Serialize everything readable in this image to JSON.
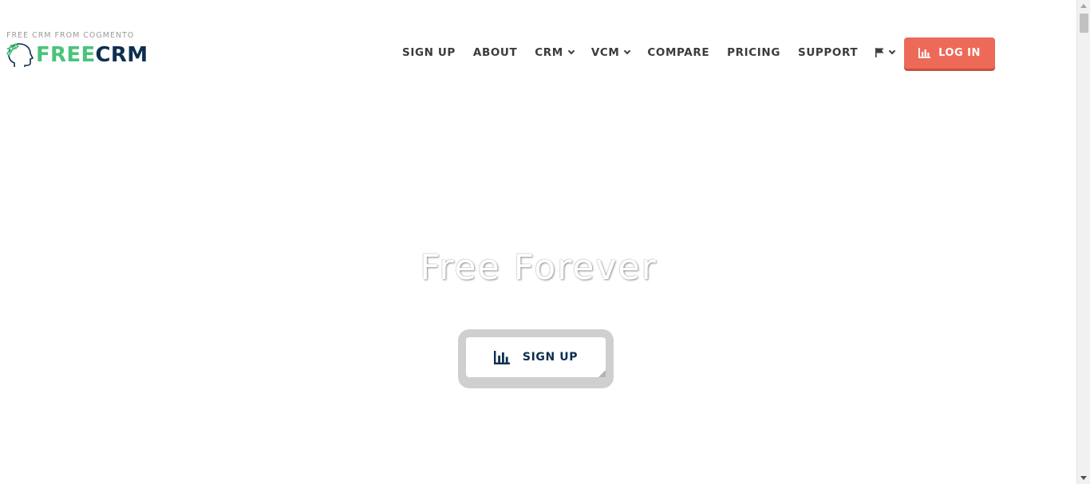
{
  "header": {
    "tagline": "FREE CRM FROM COGMENTO",
    "logo": {
      "part1": "FREE",
      "part2": "CRM",
      "icon": "head-gears-icon",
      "colors": {
        "free": "#49c47a",
        "crm": "#0d2f4f"
      }
    }
  },
  "nav": {
    "items": [
      {
        "label": "SIGN UP"
      },
      {
        "label": "ABOUT"
      },
      {
        "label": "CRM",
        "dropdown": true
      },
      {
        "label": "VCM",
        "dropdown": true
      },
      {
        "label": "COMPARE"
      },
      {
        "label": "PRICING"
      },
      {
        "label": "SUPPORT"
      }
    ],
    "language": {
      "icon": "flag-icon",
      "dropdown": true
    },
    "login": {
      "label": "LOG IN",
      "icon": "bar-chart-icon",
      "color": "#ec6a57"
    }
  },
  "hero": {
    "title": "Free Forever",
    "cta": {
      "label": "SIGN UP",
      "icon": "bar-chart-icon"
    }
  }
}
